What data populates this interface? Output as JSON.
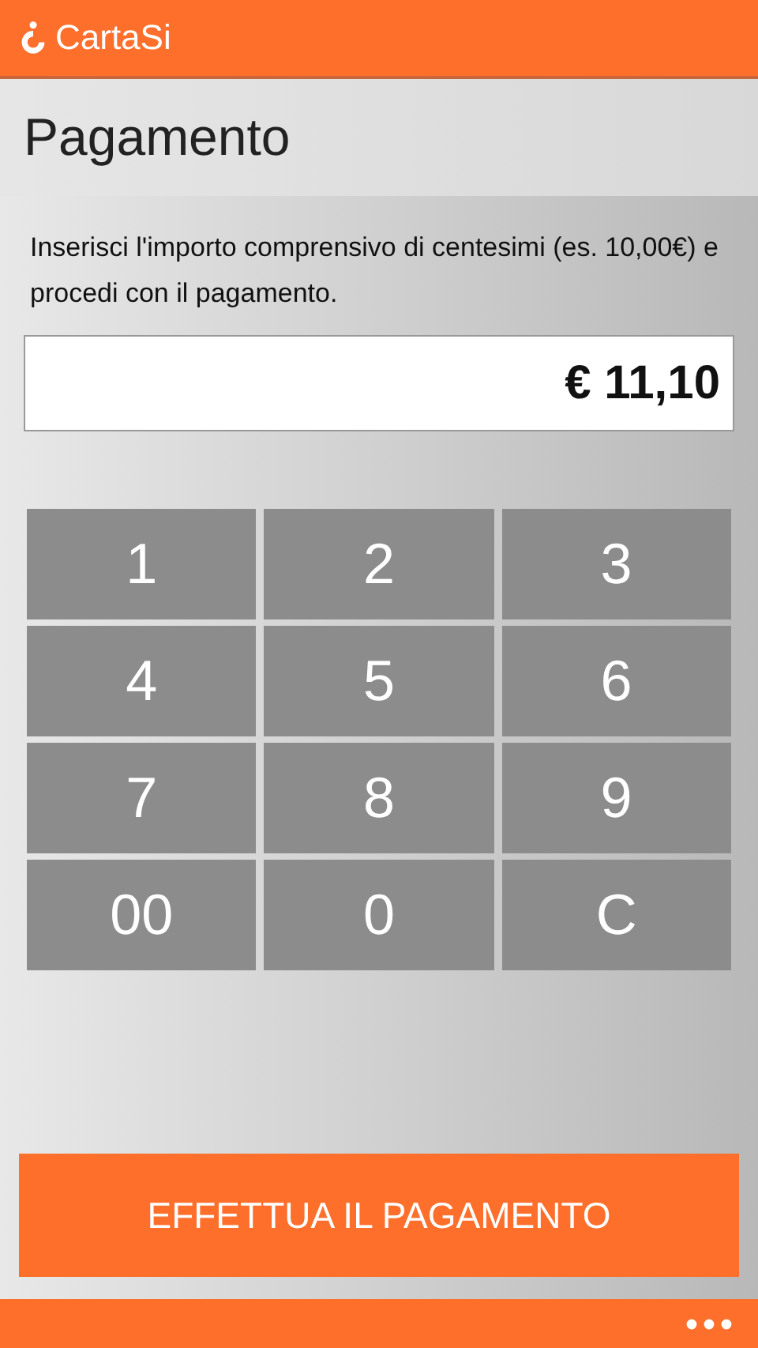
{
  "header": {
    "brand": "CartaSi"
  },
  "page_title": "Pagamento",
  "instructions": "Inserisci l'importo comprensivo di centesimi (es. 10,00€) e procedi con il pagamento.",
  "amount": {
    "value": "€ 11,10"
  },
  "keypad": [
    "1",
    "2",
    "3",
    "4",
    "5",
    "6",
    "7",
    "8",
    "9",
    "00",
    "0",
    "C"
  ],
  "pay_button": "EFFETTUA IL PAGAMENTO"
}
